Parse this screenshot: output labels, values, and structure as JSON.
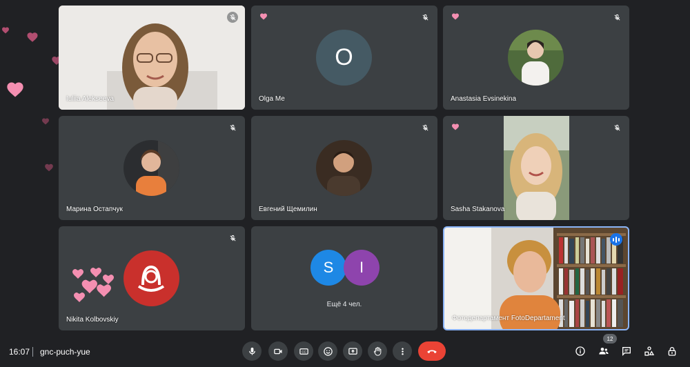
{
  "participants": [
    {
      "name": "Iuliia Alekseeva",
      "type": "video"
    },
    {
      "name": "Olga Me",
      "type": "initial",
      "initial": "O",
      "color": "#455a64"
    },
    {
      "name": "Anastasia Evsinekina",
      "type": "avatar"
    },
    {
      "name": "Марина Остапчук",
      "type": "avatar"
    },
    {
      "name": "Евгений Щемилин",
      "type": "avatar"
    },
    {
      "name": "Sasha Stakanova",
      "type": "video"
    },
    {
      "name": "Nikita Kolbovskiy",
      "type": "avatar"
    },
    {
      "name": "Фотодепартамент FotoDepartament",
      "type": "video"
    }
  ],
  "group_tile": {
    "initials": [
      "S",
      "I"
    ],
    "colors": [
      "#1e88e5",
      "#8e44ad"
    ],
    "more_label": "Ещё 4 чел."
  },
  "bottom_bar": {
    "time": "16:07",
    "meeting_code": "gnc-puch-yue",
    "participants_count": "12"
  },
  "colors": {
    "background": "#202124",
    "tile": "#3c4043",
    "hangup": "#ea4335",
    "accent": "#8ab4f8",
    "heart": "#f48fb1"
  },
  "icons": [
    "mic-icon",
    "camera-icon",
    "captions-icon",
    "emoji-icon",
    "present-icon",
    "raise-hand-icon",
    "more-icon",
    "hangup-icon",
    "info-icon",
    "people-icon",
    "chat-icon",
    "activities-icon",
    "host-controls-icon"
  ]
}
